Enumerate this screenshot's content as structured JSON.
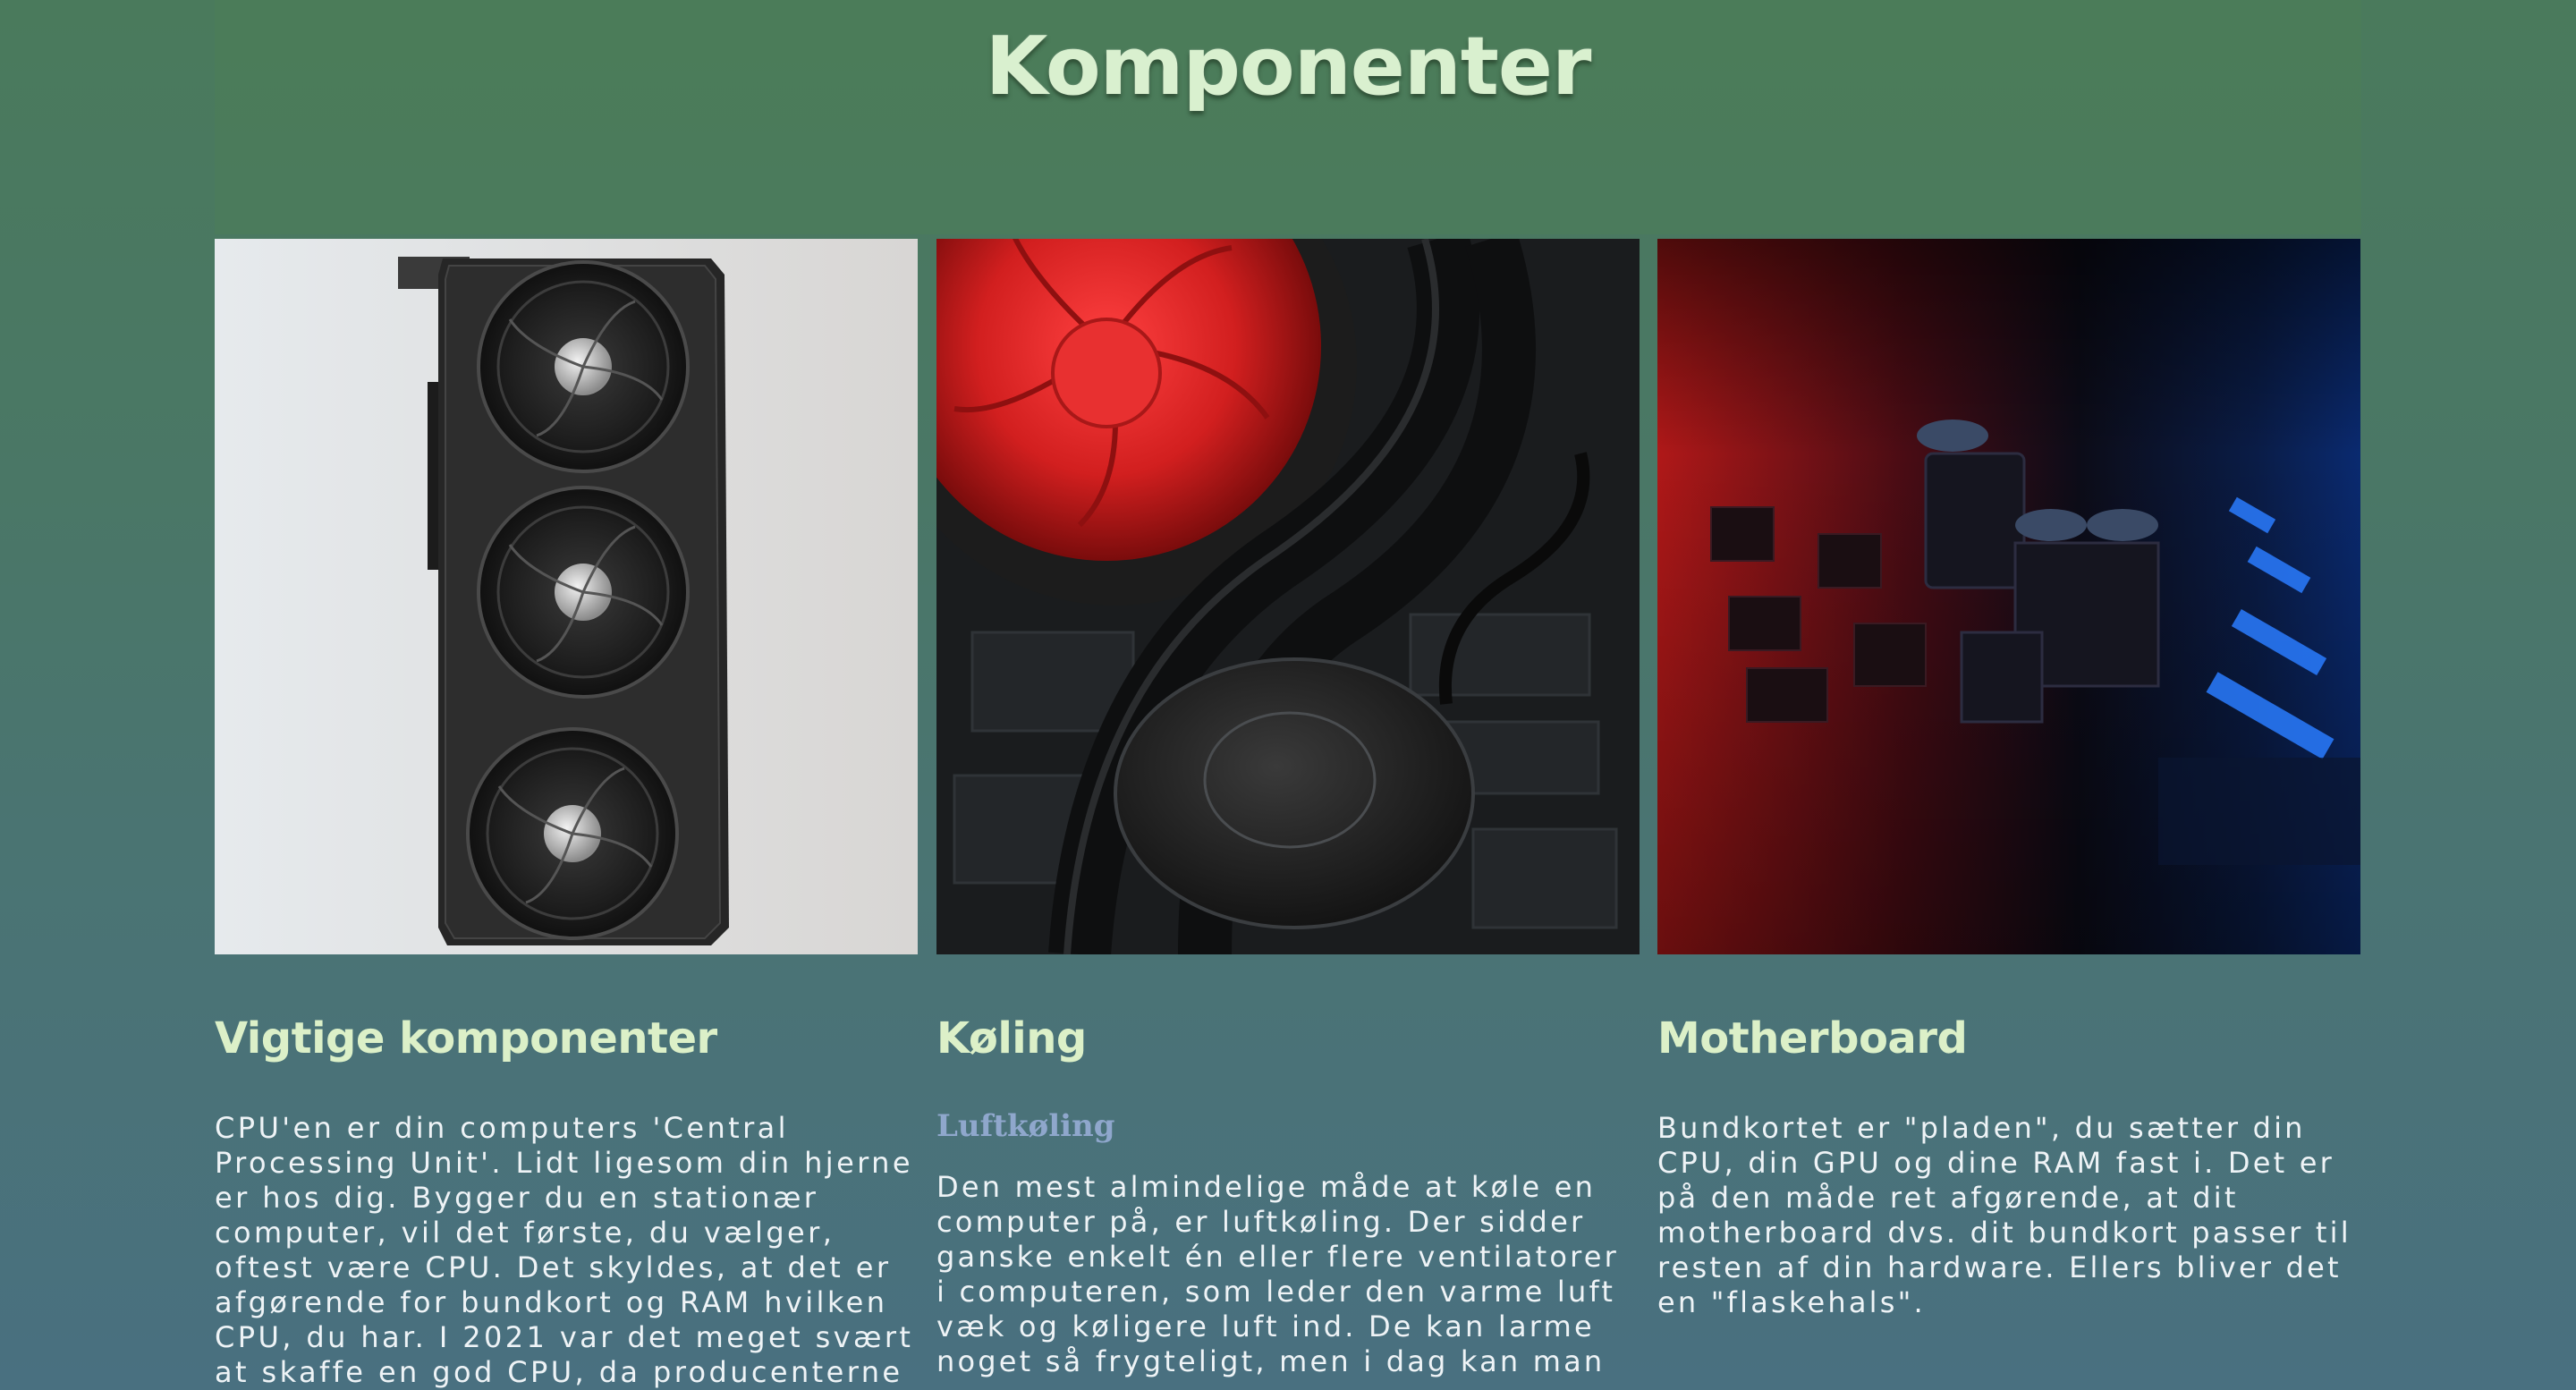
{
  "page": {
    "title": "Komponenter"
  },
  "cards": [
    {
      "image_alt": "graphics-card-photo",
      "heading": "Vigtige komponenter",
      "text": "CPU'en er din computers 'Central Processing Unit'. Lidt ligesom din hjerne er hos dig. Bygger du en stationær computer, vil det første, du vælger, oftest være CPU. Det skyldes, at det er afgørende for bundkort og RAM hvilken CPU, du har. I 2021 var det meget svært at skaffe en god CPU, da producenterne"
    },
    {
      "image_alt": "cpu-cooler-photo",
      "heading": "Køling",
      "subheading": "Luftkøling",
      "text": "Den mest almindelige måde at køle en computer på, er luftkøling. Der sidder ganske enkelt én eller flere ventilatorer i computeren, som leder den varme luft væk og køligere luft ind. De kan larme noget så frygteligt, men i dag kan man"
    },
    {
      "image_alt": "motherboard-photo",
      "heading": "Motherboard",
      "text": "Bundkortet er \"pladen\", du sætter din CPU, din GPU og dine RAM fast i. Det er på den måde ret afgørende, at dit motherboard dvs. dit bundkort passer til resten af din hardware. Ellers bliver det en \"flaskehals\"."
    }
  ],
  "colors": {
    "heading": "#dcf0c8",
    "subheading": "#8fa7cc",
    "body_text": "#eef3f6",
    "title": "#d9f0cf"
  }
}
